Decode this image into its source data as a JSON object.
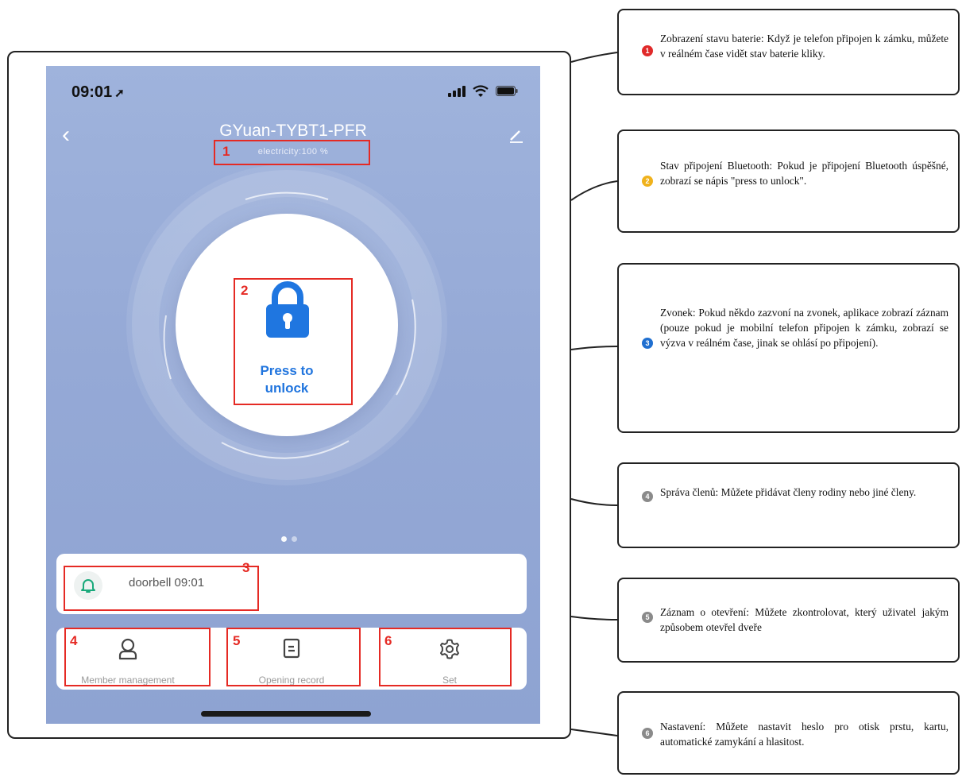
{
  "status_bar": {
    "time": "09:01",
    "location_icon": "location-arrow-icon",
    "signal_icon": "signal-icon",
    "wifi_icon": "wifi-icon",
    "battery_icon": "battery-icon"
  },
  "header": {
    "title": "GYuan-TYBT1-PFR",
    "electricity": "electricity:100 %",
    "back_icon": "back-chevron-icon",
    "edit_icon": "pencil-icon"
  },
  "unlock": {
    "label_line1": "Press to",
    "label_line2": "unlock",
    "icon": "padlock-icon",
    "icon_color": "#1f76e0"
  },
  "pager": {
    "count": 2,
    "active_index": 0
  },
  "doorbell": {
    "text": "doorbell 09:01",
    "icon": "bell-icon",
    "icon_color": "#19a97b"
  },
  "actions": [
    {
      "label": "Member management",
      "icon": "person-icon"
    },
    {
      "label": "Opening record",
      "icon": "document-icon"
    },
    {
      "label": "Set",
      "icon": "gear-icon"
    }
  ],
  "highlight_numbers": [
    "1",
    "2",
    "3",
    "4",
    "5",
    "6"
  ],
  "callouts": [
    {
      "marker": "1",
      "color": "#e02a2a",
      "text": "Zobrazení stavu baterie: Když je telefon připojen k zámku, můžete v reálném čase vidět stav baterie kliky."
    },
    {
      "marker": "2",
      "color": "#f0b21c",
      "text": "Stav připojení Bluetooth: Pokud je připojení Bluetooth úspěšné, zobrazí se nápis \"press to unlock\"."
    },
    {
      "marker": "3",
      "color": "#1f6fd0",
      "text": "Zvonek: Pokud někdo zazvoní na zvonek, aplikace zobrazí záznam (pouze pokud je mobilní telefon připojen k zámku, zobrazí se výzva v reálném čase, jinak se ohlásí po připojení)."
    },
    {
      "marker": "4",
      "color": "#8a8a8a",
      "text": "Správa členů: Můžete přidávat členy rodiny nebo jiné členy."
    },
    {
      "marker": "5",
      "color": "#8a8a8a",
      "text": "Záznam o otevření: Můžete zkontrolovat, který uživatel jakým způsobem otevřel dveře"
    },
    {
      "marker": "6",
      "color": "#8a8a8a",
      "text": "Nastavení: Můžete nastavit heslo pro otisk prstu, kartu, automatické zamykání a hlasitost."
    }
  ],
  "colors": {
    "screen_bg": "#98acd8",
    "highlight": "#e52a24",
    "accent_blue": "#2175de"
  }
}
